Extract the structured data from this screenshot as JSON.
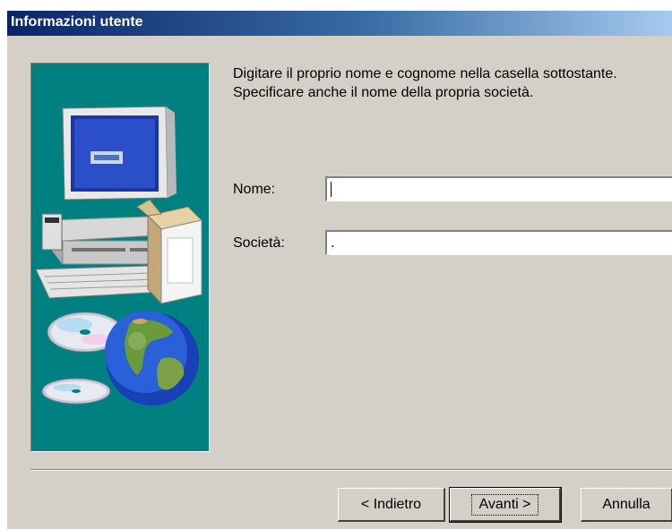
{
  "window": {
    "title": "Informazioni utente"
  },
  "intro": {
    "line1": "Digitare il proprio nome e cognome nella casella sottostante.",
    "line2": "Specificare anche il nome della propria società."
  },
  "form": {
    "name_label": "Nome:",
    "name_value": "",
    "company_label": "Società:",
    "company_value": "."
  },
  "buttons": {
    "back": "< Indietro",
    "next": "Avanti >",
    "cancel": "Annulla"
  },
  "colors": {
    "title_gradient_start": "#0a246a",
    "dialog_background": "#d4d0c8",
    "illustration_background": "#008080"
  },
  "illustration": {
    "icons": [
      "computer-icon",
      "box-icon",
      "cd-icon",
      "globe-icon"
    ]
  }
}
